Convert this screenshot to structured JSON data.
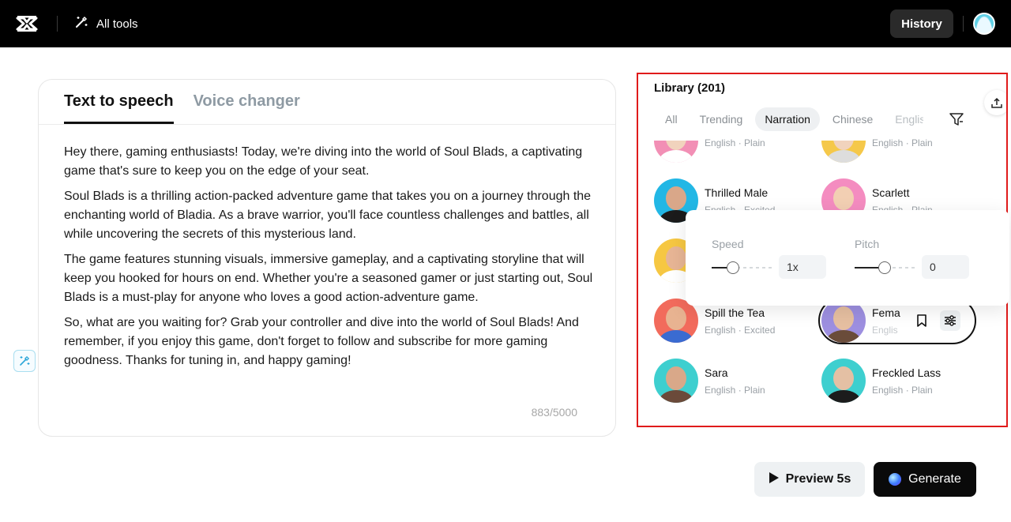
{
  "topbar": {
    "all_tools": "All tools",
    "history": "History"
  },
  "editor": {
    "tabs": [
      {
        "label": "Text to speech"
      },
      {
        "label": "Voice changer"
      }
    ],
    "paragraphs": [
      "Hey there, gaming enthusiasts! Today, we're diving into the world of Soul Blads, a captivating game that's sure to keep you on the edge of your seat.",
      "Soul Blads is a thrilling action-packed adventure game that takes you on a journey through the enchanting world of Bladia. As a brave warrior, you'll face countless challenges and battles, all while uncovering the secrets of this mysterious land.",
      "The game features stunning visuals, immersive gameplay, and a captivating storyline that will keep you hooked for hours on end. Whether you're a seasoned gamer or just starting out, Soul Blads is a must-play for anyone who loves a good action-adventure game.",
      "So, what are you waiting for? Grab your controller and dive into the world of Soul Blads! And remember, if you enjoy this game, don't forget to follow and subscribe for more gaming goodness. Thanks for tuning in, and happy gaming!"
    ],
    "char_count": "883/5000"
  },
  "library": {
    "title": "Library (201)",
    "filters": [
      "All",
      "Trending",
      "Narration",
      "Chinese",
      "Englis"
    ],
    "active_filter": "Narration",
    "voices": [
      {
        "name": "",
        "meta": "English · Plain"
      },
      {
        "name": "",
        "meta": "English · Plain"
      },
      {
        "name": "Thrilled Male",
        "meta": "English · Excited"
      },
      {
        "name": "Scarlett",
        "meta": "English · Plain"
      },
      {
        "name": "Spill the Tea",
        "meta": "English · Excited"
      },
      {
        "name": "Fema",
        "meta": "Englis"
      },
      {
        "name": "Sara",
        "meta": "English · Plain"
      },
      {
        "name": "Freckled Lass",
        "meta": "English · Plain"
      }
    ],
    "settings": {
      "speed_label": "Speed",
      "speed_value": "1x",
      "speed_level": 0.35,
      "pitch_label": "Pitch",
      "pitch_value": "0",
      "pitch_level": 0.5
    }
  },
  "actions": {
    "preview": "Preview 5s",
    "generate": "Generate"
  },
  "colors": {
    "topbar": "#000000",
    "highlight_border": "#e01b1b",
    "accent": "#111111"
  }
}
